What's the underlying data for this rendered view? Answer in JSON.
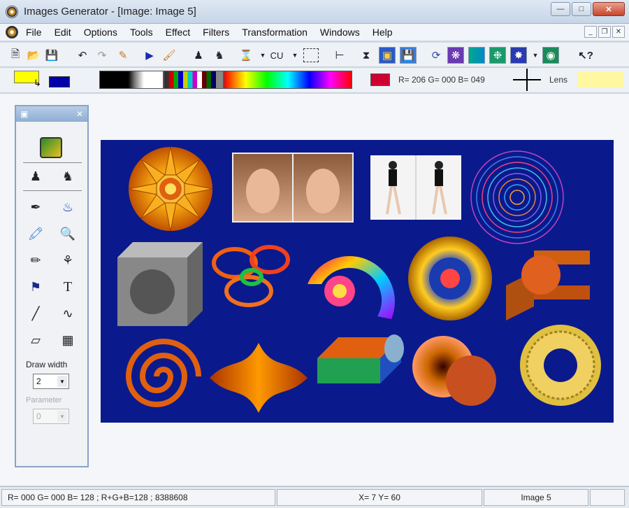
{
  "window": {
    "title": "Images Generator - [Image: Image 5]"
  },
  "menu": [
    "File",
    "Edit",
    "Options",
    "Tools",
    "Effect",
    "Filters",
    "Transformation",
    "Windows",
    "Help"
  ],
  "toolbar": {
    "size_button": "CU"
  },
  "palette": {
    "foreground": "#ffff00",
    "background": "#0000aa",
    "selected_color": "#ce0031",
    "rgb_readout": "R= 206  G= 000  B= 049",
    "lens_label": "Lens"
  },
  "tools_panel": {
    "draw_width_label": "Draw width",
    "draw_width_value": "2",
    "parameter_label": "Parameter",
    "parameter_value": "0"
  },
  "canvas": {
    "background": "#0a1a8c"
  },
  "status": {
    "color_info": "R= 000  G= 000  B= 128  ;   R+G+B=128  ;   8388608",
    "coords": "X= 7   Y= 60",
    "image_name": "Image 5"
  }
}
